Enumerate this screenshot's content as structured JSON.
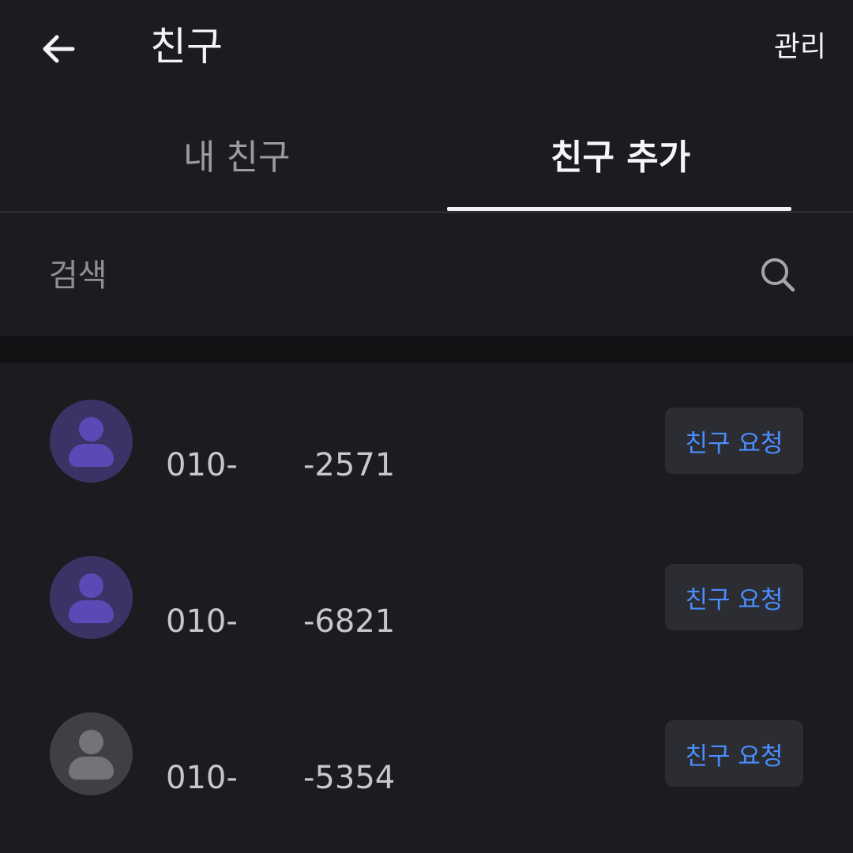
{
  "header": {
    "title": "친구",
    "manage_label": "관리"
  },
  "tabs": [
    {
      "label": "내 친구",
      "active": false
    },
    {
      "label": "친구 추가",
      "active": true
    }
  ],
  "search": {
    "placeholder": "검색",
    "value": ""
  },
  "friends": [
    {
      "phone_prefix": "010-",
      "phone_suffix": "-2571",
      "avatar_color": "purple",
      "action_label": "친구 요청"
    },
    {
      "phone_prefix": "010-",
      "phone_suffix": "-6821",
      "avatar_color": "purple",
      "action_label": "친구 요청"
    },
    {
      "phone_prefix": "010-",
      "phone_suffix": "-5354",
      "avatar_color": "gray",
      "action_label": "친구 요청"
    }
  ],
  "colors": {
    "background": "#1b1b20",
    "accent": "#4a8eff",
    "avatar_purple": "#3a3366",
    "avatar_gray": "#3f4043"
  },
  "icons": [
    "back-arrow-icon",
    "search-icon",
    "person-icon"
  ]
}
